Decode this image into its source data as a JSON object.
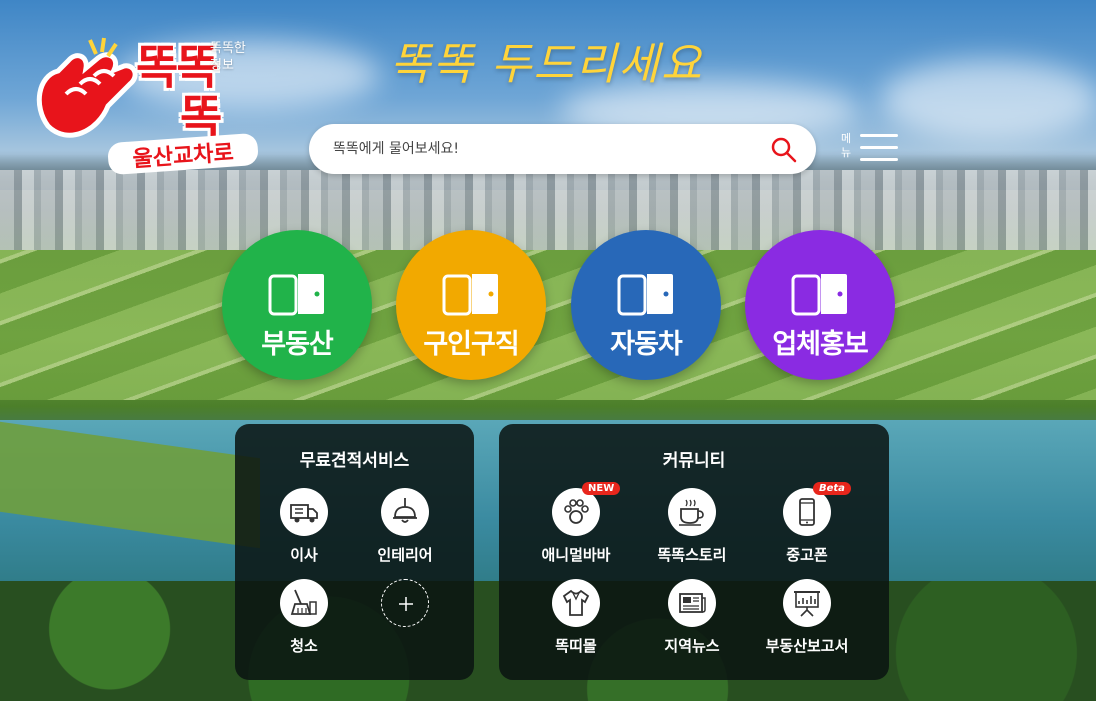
{
  "logo": {
    "main_line1": "똑똑",
    "main_line2": "똑",
    "sub": "울산교차로",
    "tag_line1": "똑똑한",
    "tag_line2": "정보"
  },
  "headline": "똑똑 두드리세요",
  "search": {
    "placeholder": "똑똑에게 물어보세요!",
    "icon": "search-icon"
  },
  "menu": {
    "label": "메뉴",
    "icon": "hamburger-icon"
  },
  "categories": [
    {
      "label": "부동산",
      "color": "#21b34a",
      "icon": "door-icon"
    },
    {
      "label": "구인구직",
      "color": "#f2a900",
      "icon": "door-icon"
    },
    {
      "label": "자동차",
      "color": "#2868b8",
      "icon": "door-icon"
    },
    {
      "label": "업체홍보",
      "color": "#8a2be2",
      "icon": "door-icon"
    }
  ],
  "estimate_panel": {
    "title": "무료견적서비스",
    "items": [
      {
        "label": "이사",
        "icon": "moving-truck-icon"
      },
      {
        "label": "인테리어",
        "icon": "pendant-lamp-icon"
      },
      {
        "label": "청소",
        "icon": "broom-icon"
      },
      {
        "label": "",
        "icon": "plus-icon"
      }
    ]
  },
  "community_panel": {
    "title": "커뮤니티",
    "items": [
      {
        "label": "애니멀바바",
        "icon": "paw-icon",
        "badge": "NEW"
      },
      {
        "label": "똑똑스토리",
        "icon": "coffee-cup-icon"
      },
      {
        "label": "중고폰",
        "icon": "smartphone-icon",
        "badge": "Beta"
      },
      {
        "label": "똑띠몰",
        "icon": "shirt-icon"
      },
      {
        "label": "지역뉴스",
        "icon": "newspaper-icon"
      },
      {
        "label": "부동산보고서",
        "icon": "presentation-board-icon"
      }
    ]
  },
  "colors": {
    "logo_red": "#e8141b",
    "headline_yellow": "#ffd43a",
    "badge_red": "#e8261c"
  }
}
